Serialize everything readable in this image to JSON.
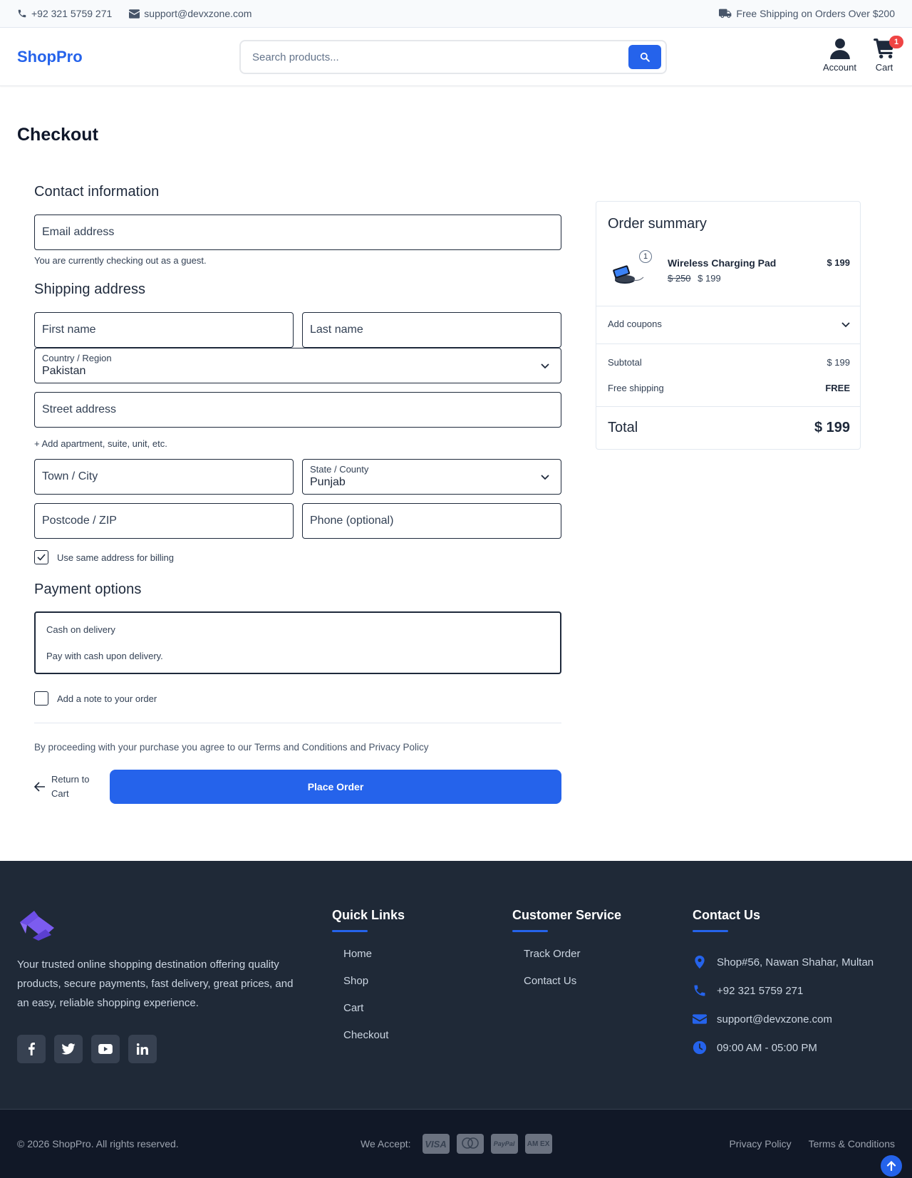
{
  "topbar": {
    "phone": "+92 321 5759 271",
    "email": "support@devxzone.com",
    "shipping_note": "Free Shipping on Orders Over $200"
  },
  "header": {
    "logo": "ShopPro",
    "search_placeholder": "Search products...",
    "account_label": "Account",
    "cart_label": "Cart",
    "cart_count": "1"
  },
  "page": {
    "title": "Checkout"
  },
  "contact": {
    "heading": "Contact information",
    "email_placeholder": "Email address",
    "guest_note": "You are currently checking out as a guest."
  },
  "shipping": {
    "heading": "Shipping address",
    "first_name": "First name",
    "last_name": "Last name",
    "country_label": "Country / Region",
    "country_value": "Pakistan",
    "street": "Street address",
    "add_apartment": "+ Add apartment, suite, unit, etc.",
    "city": "Town / City",
    "state_label": "State / County",
    "state_value": "Punjab",
    "postcode": "Postcode / ZIP",
    "phone": "Phone (optional)",
    "same_billing": "Use same address for billing",
    "same_billing_checked": true
  },
  "payment": {
    "heading": "Payment options",
    "method": "Cash on delivery",
    "description": "Pay with cash upon delivery.",
    "add_note": "Add a note to your order"
  },
  "terms": "By proceeding with your purchase you agree to our Terms and Conditions and Privacy Policy",
  "actions": {
    "return_line1": "Return to",
    "return_line2": "Cart",
    "place_order": "Place Order"
  },
  "summary": {
    "title": "Order summary",
    "item": {
      "name": "Wireless Charging Pad",
      "qty": "1",
      "old_price": "$ 250",
      "price": "$ 199",
      "line_total": "$ 199"
    },
    "coupons": "Add coupons",
    "subtotal_label": "Subtotal",
    "subtotal_value": "$ 199",
    "shipping_label": "Free shipping",
    "shipping_value": "FREE",
    "total_label": "Total",
    "total_value": "$ 199"
  },
  "footer": {
    "description": "Your trusted online shopping destination offering quality products, secure payments, fast delivery, great prices, and an easy, reliable shopping experience.",
    "quick_links": {
      "heading": "Quick Links",
      "items": [
        "Home",
        "Shop",
        "Cart",
        "Checkout"
      ]
    },
    "customer_service": {
      "heading": "Customer Service",
      "items": [
        "Track Order",
        "Contact Us"
      ]
    },
    "contact": {
      "heading": "Contact Us",
      "address": "Shop#56, Nawan Shahar, Multan",
      "phone": "+92 321 5759 271",
      "email": "support@devxzone.com",
      "hours": "09:00 AM - 05:00 PM"
    },
    "socials": [
      "facebook-icon",
      "twitter-icon",
      "youtube-icon",
      "linkedin-icon"
    ]
  },
  "bottom": {
    "copyright": "© 2026 ShopPro. All rights reserved.",
    "we_accept": "We Accept:",
    "cards": [
      "VISA",
      "mastercard",
      "PayPal",
      "AM EX"
    ],
    "privacy": "Privacy Policy",
    "terms": "Terms & Conditions"
  },
  "colors": {
    "accent": "#2563eb",
    "footer_bg": "#1f2937",
    "bottom_bg": "#111827",
    "badge": "#ef4444"
  }
}
